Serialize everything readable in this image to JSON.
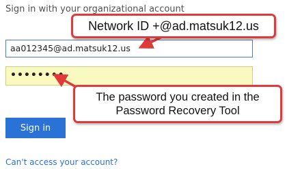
{
  "form": {
    "heading": "Sign in with your organizational account",
    "username_value": "aa012345@ad.matsuk12.us",
    "password_value": "••••••••",
    "signin_label": "Sign in",
    "help_link": "Can't access your account?"
  },
  "annotations": {
    "network_id": "Network ID +@ad.matsuk12.us",
    "password_line1": "The password you created in the",
    "password_line2": "Password Recovery Tool"
  },
  "colors": {
    "accent": "#2a72d6",
    "callout_border": "#e03a3a",
    "password_fill": "#fafac0"
  }
}
